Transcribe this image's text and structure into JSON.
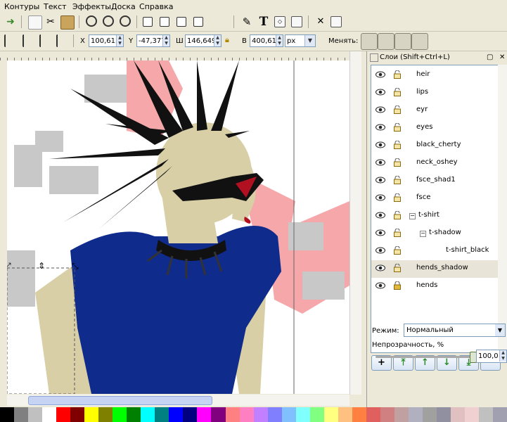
{
  "menu": [
    "Контуры",
    "Текст",
    "Эффекты",
    "Доска",
    "Справка"
  ],
  "toolbar": {
    "x_label": "X",
    "x_value": "100,613",
    "y_label": "Y",
    "y_value": "-47,377",
    "w_label": "Ш",
    "w_value": "146,649",
    "h_label": "В",
    "h_value": "400,610",
    "unit": "px",
    "change_label": "Менять:"
  },
  "layers_panel": {
    "title": "Слои (Shift+Ctrl+L)",
    "layers": [
      {
        "name": "heir",
        "indent": 0,
        "locked": false
      },
      {
        "name": "lips",
        "indent": 0,
        "locked": false
      },
      {
        "name": "eyr",
        "indent": 0,
        "locked": false
      },
      {
        "name": "eyes",
        "indent": 0,
        "locked": false
      },
      {
        "name": "black_cherty",
        "indent": 0,
        "locked": false
      },
      {
        "name": "neck_oshey",
        "indent": 0,
        "locked": false
      },
      {
        "name": "fsce_shad1",
        "indent": 0,
        "locked": false
      },
      {
        "name": "fsce",
        "indent": 0,
        "locked": false
      },
      {
        "name": "t-shirt",
        "indent": 0,
        "expander": "−",
        "locked": false
      },
      {
        "name": "t-shadow",
        "indent": 1,
        "expander": "−",
        "locked": false
      },
      {
        "name": "t-shirt_black",
        "indent": 2,
        "locked": false
      },
      {
        "name": "hends_shadow",
        "indent": 0,
        "selected": true,
        "locked": false
      },
      {
        "name": "hends",
        "indent": 0,
        "locked": true
      }
    ],
    "mode_label": "Режим:",
    "mode_value": "Нормальный",
    "opacity_label": "Непрозрачность, %",
    "opacity_value": "100,0",
    "opacity": 1.0
  },
  "colors": {
    "shirt": "#0f2b8c",
    "skin": "#d8cfa6",
    "hair": "#111111",
    "pink": "#f6a7aa",
    "palette": [
      "#000000",
      "#808080",
      "#c0c0c0",
      "#ffffff",
      "#ff0000",
      "#800000",
      "#ffff00",
      "#808000",
      "#00ff00",
      "#008000",
      "#00ffff",
      "#008080",
      "#0000ff",
      "#000080",
      "#ff00ff",
      "#800080",
      "#ff8080",
      "#ff80c0",
      "#c080ff",
      "#8080ff",
      "#80c0ff",
      "#80ffff",
      "#80ff80",
      "#ffff80",
      "#ffc080",
      "#ff8040",
      "#e06060",
      "#d08080",
      "#c0a0a0",
      "#b0b0c0",
      "#a0a0a0",
      "#9090a0",
      "#e0c0c0",
      "#f0d0d0",
      "#c0c0c0",
      "#a0a0b0"
    ]
  }
}
